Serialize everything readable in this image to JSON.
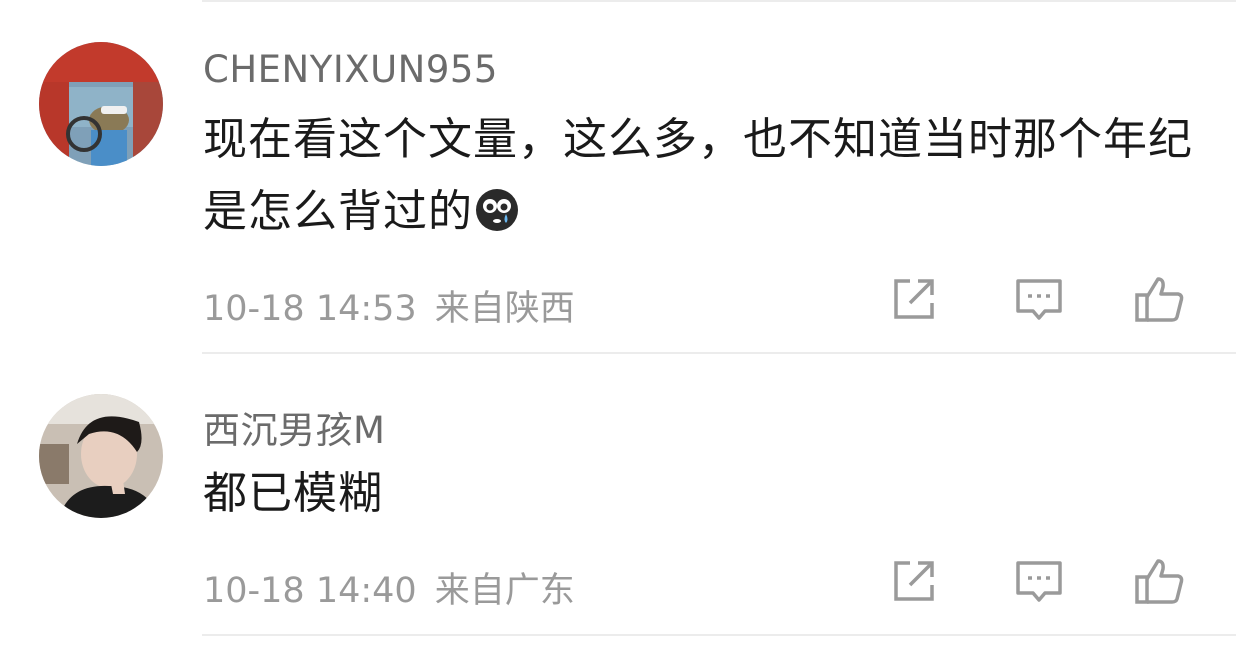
{
  "comments": [
    {
      "username": "CHENYIXUN955",
      "content": "现在看这个文量，这么多，也不知道当时那个年纪是怎么背过的",
      "emoji_icon": "tearful-face-emoji",
      "time": "10-18 14:53",
      "location": "来自陕西",
      "avatar_icon": "avatar-car-character"
    },
    {
      "username": "西沉男孩M",
      "content": "都已模糊",
      "time": "10-18 14:40",
      "location": "来自广东",
      "avatar_icon": "avatar-person-photo"
    }
  ],
  "actions": {
    "share_icon": "share-icon",
    "comment_icon": "comment-icon",
    "like_icon": "thumbs-up-icon",
    "icon_color": "#9a9a9a"
  },
  "colors": {
    "username": "#6b6b6b",
    "content": "#1a1a1a",
    "meta": "#9a9a9a",
    "divider": "#ececec"
  }
}
